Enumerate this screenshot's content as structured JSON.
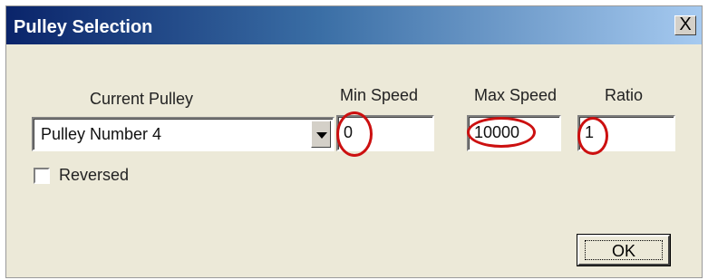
{
  "window": {
    "title": "Pulley Selection",
    "close_label": "X"
  },
  "current_pulley": {
    "label": "Current Pulley",
    "value": "Pulley Number 4"
  },
  "min_speed": {
    "label": "Min Speed",
    "value": "0"
  },
  "max_speed": {
    "label": "Max Speed",
    "value": "10000"
  },
  "ratio": {
    "label": "Ratio",
    "value": "1"
  },
  "reversed": {
    "label": "Reversed",
    "checked": false
  },
  "ok_label": "OK",
  "annotation_color": "#cc1010"
}
